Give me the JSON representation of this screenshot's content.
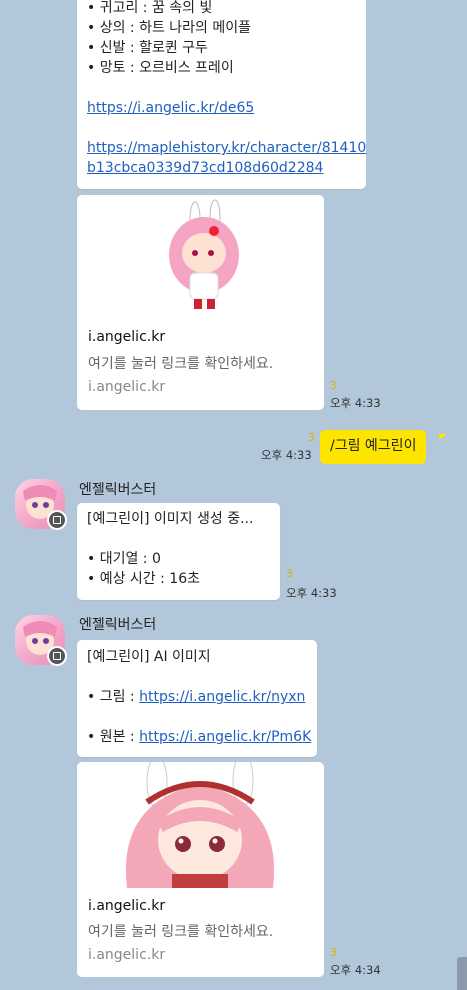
{
  "msg1": {
    "lines": [
      "• 귀고리 : 꿈 속의 빛",
      "• 상의 : 하트 나라의 메이플",
      "• 신발 : 할로퀸 구두",
      "• 망토 : 오르비스 프레이"
    ],
    "link1": "https://i.angelic.kr/de65",
    "link2_line1": "https://maplehistory.kr/character/81410",
    "link2_line2": "b13cbca0339d73cd108d60d2284"
  },
  "card1": {
    "title": "i.angelic.kr",
    "desc": "여기를 눌러 링크를 확인하세요.",
    "domain": "i.angelic.kr",
    "unread": "3",
    "time": "오후 4:33"
  },
  "my_msg": {
    "text": "/그림 예그린이",
    "unread": "3",
    "time": "오후 4:33"
  },
  "bot1": {
    "sender": "엔젤릭버스터",
    "line1": "[예그린이] 이미지 생성 중...",
    "line2": "• 대기열 : 0",
    "line3": "• 예상 시간 : 16초",
    "unread": "3",
    "time": "오후 4:33"
  },
  "bot2": {
    "sender": "엔젤릭버스터",
    "line1": "[예그린이] AI 이미지",
    "line2_label": "• 그림 : ",
    "line2_link": "https://i.angelic.kr/nyxn",
    "line3_label": "• 원본 : ",
    "line3_link": "https://i.angelic.kr/Pm6K"
  },
  "card2": {
    "title": "i.angelic.kr",
    "desc": "여기를 눌러 링크를 확인하세요.",
    "domain": "i.angelic.kr",
    "unread": "3",
    "time": "오후 4:34"
  },
  "colors": {
    "background": "#b2c7da",
    "my_bubble": "#fee500",
    "link": "#1f5fbf",
    "unread": "#d5b400"
  }
}
